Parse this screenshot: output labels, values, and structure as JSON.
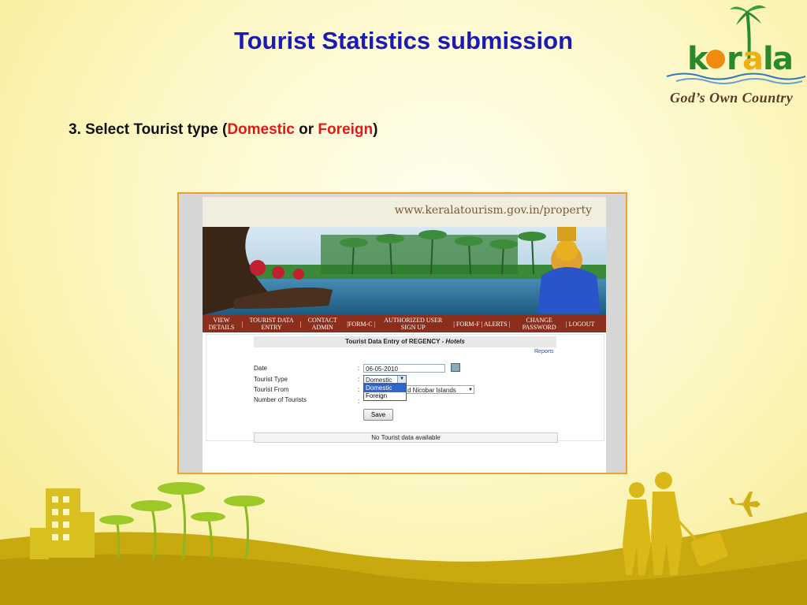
{
  "slide": {
    "title": "Tourist Statistics submission",
    "step_prefix": "3. Select Tourist type (",
    "step_domestic": "Domestic",
    "step_or": " or ",
    "step_foreign": "Foreign",
    "step_suffix": ")"
  },
  "logo": {
    "wordmark": "kerala",
    "tagline": "God’s Own Country"
  },
  "browser": {
    "url": "www.keralatourism.gov.in/property"
  },
  "nav": {
    "items": [
      {
        "label": "VIEW\nDETAILS"
      },
      {
        "label": "TOURIST DATA\nENTRY"
      },
      {
        "label": "CONTACT\nADMIN"
      },
      {
        "label": "|FORM-C |"
      },
      {
        "label": "AUTHORIZED USER\nSIGN UP"
      },
      {
        "label": "| FORM-F | ALERTS |"
      },
      {
        "label": "CHANGE\nPASSWORD"
      },
      {
        "label": "| LOGOUT"
      }
    ],
    "separator": "|"
  },
  "form": {
    "heading_main": "Tourist Data Entry of REGENCY  -  ",
    "heading_type": "Hotels",
    "reports_link": "Reports",
    "labels": {
      "date": "Date",
      "tourist_type": "Tourist Type",
      "tourist_from": "Tourist From",
      "number_of_tourists": "Number of Tourists"
    },
    "colon": ":",
    "date_value": "06-05-2010",
    "tourist_type_value": "Domestic",
    "tourist_type_options": [
      "Domestic",
      "Foreign"
    ],
    "tourist_from_value": "d Nicobar Islands",
    "save_label": "Save",
    "no_data": "No Tourist data available"
  },
  "colors": {
    "title": "#1a1ab4",
    "highlight": "#e01919",
    "frame_border": "#f0a030",
    "nav_bg": "#8b2f1c"
  }
}
